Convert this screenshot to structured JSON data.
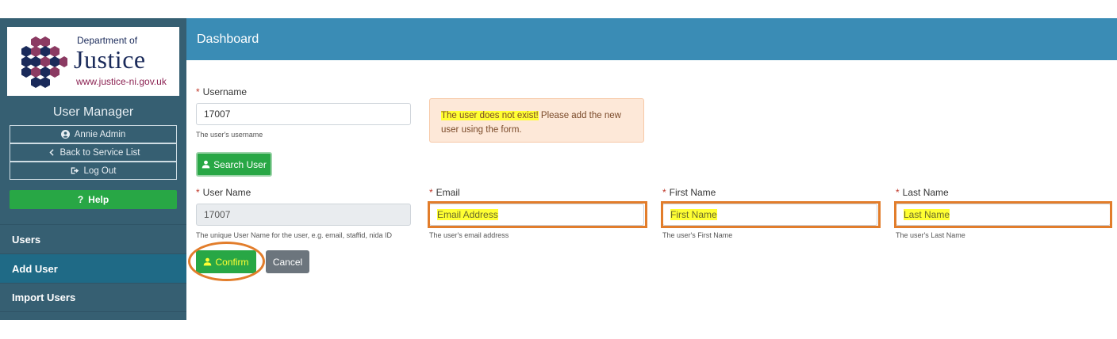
{
  "sidebar": {
    "logo": {
      "dept": "Department of",
      "name": "Justice",
      "url": "www.justice-ni.gov.uk"
    },
    "title": "User Manager",
    "user_buttons": [
      {
        "label": "Annie Admin",
        "icon": "user-circle-icon"
      },
      {
        "label": "Back to Service List",
        "icon": "chevron-left-icon"
      },
      {
        "label": "Log Out",
        "icon": "sign-out-icon"
      }
    ],
    "help_label": "Help",
    "nav": [
      {
        "label": "Users",
        "active": false
      },
      {
        "label": "Add User",
        "active": true
      },
      {
        "label": "Import Users",
        "active": false
      }
    ]
  },
  "header": {
    "title": "Dashboard"
  },
  "form": {
    "username": {
      "label": "Username",
      "value": "17007",
      "hint": "The user's username"
    },
    "search_button": "Search User",
    "alert": {
      "highlight": "The user does not exist!",
      "rest": " Please add the new user using the form."
    },
    "user_name": {
      "label": "User Name",
      "value": "17007",
      "hint": "The unique User Name for the user, e.g. email, staffid, nida ID"
    },
    "email": {
      "label": "Email",
      "placeholder": "Email Address",
      "hint": "The user's email address"
    },
    "first_name": {
      "label": "First Name",
      "placeholder": "First Name",
      "hint": "The user's First Name"
    },
    "last_name": {
      "label": "Last Name",
      "placeholder": "Last Name",
      "hint": "The user's Last Name"
    },
    "confirm_button": "Confirm",
    "cancel_button": "Cancel"
  },
  "colors": {
    "sidebar": "#365f72",
    "header": "#3a8cb5",
    "active_nav": "#1f6a86",
    "success": "#28a745",
    "annotation": "#e27d2b",
    "highlight": "#ffff33"
  }
}
